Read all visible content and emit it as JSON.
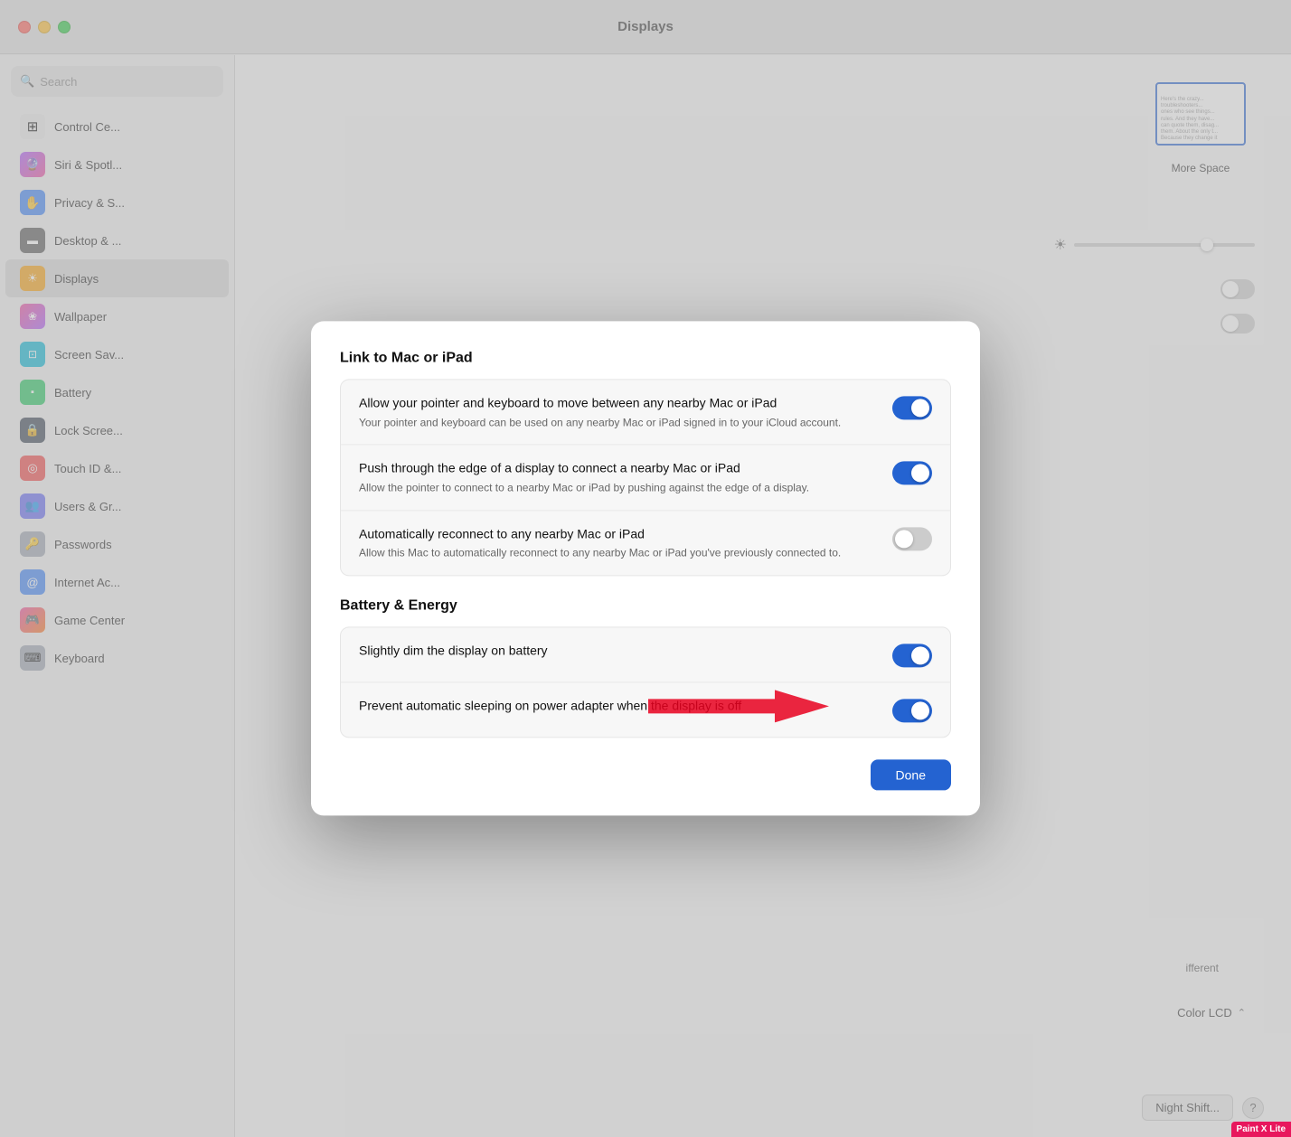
{
  "window": {
    "title": "Displays",
    "traffic_lights": {
      "close": "close",
      "minimize": "minimize",
      "zoom": "zoom"
    }
  },
  "sidebar": {
    "search_placeholder": "Search",
    "items": [
      {
        "id": "control-center",
        "label": "Control Ce...",
        "icon": "⊞",
        "color": "#888"
      },
      {
        "id": "siri-spotlight",
        "label": "Siri & Spotl...",
        "icon": "🔮",
        "color": "#a855f7"
      },
      {
        "id": "privacy",
        "label": "Privacy & S...",
        "icon": "✋",
        "color": "#2563eb"
      },
      {
        "id": "desktop",
        "label": "Desktop & ...",
        "icon": "▬",
        "color": "#555"
      },
      {
        "id": "displays",
        "label": "Displays",
        "icon": "☀",
        "color": "#f59e0b",
        "active": true
      },
      {
        "id": "wallpaper",
        "label": "Wallpaper",
        "icon": "❀",
        "color": "#ec4899"
      },
      {
        "id": "screensaver",
        "label": "Screen Sav...",
        "icon": "⊡",
        "color": "#06b6d4"
      },
      {
        "id": "battery",
        "label": "Battery",
        "icon": "▪",
        "color": "#22c55e"
      },
      {
        "id": "lock-screen",
        "label": "Lock Scree...",
        "icon": "🔒",
        "color": "#374151"
      },
      {
        "id": "touch-id",
        "label": "Touch ID &...",
        "icon": "◎",
        "color": "#ef4444"
      },
      {
        "id": "users",
        "label": "Users & Gr...",
        "icon": "👥",
        "color": "#6366f1"
      },
      {
        "id": "passwords",
        "label": "Passwords",
        "icon": "🔑",
        "color": "#555"
      },
      {
        "id": "internet",
        "label": "Internet Ac...",
        "icon": "@",
        "color": "#3b82f6"
      },
      {
        "id": "game-center",
        "label": "Game Center",
        "icon": "🎮",
        "color": "#ec4899"
      },
      {
        "id": "keyboard",
        "label": "Keyboard",
        "icon": "⌨",
        "color": "#888"
      }
    ]
  },
  "modal": {
    "link_section_title": "Link to Mac or iPad",
    "link_settings": [
      {
        "id": "pointer-keyboard",
        "title": "Allow your pointer and keyboard to move between any nearby Mac or iPad",
        "desc": "Your pointer and keyboard can be used on any nearby Mac or iPad signed in to your iCloud account.",
        "toggle": true
      },
      {
        "id": "push-edge",
        "title": "Push through the edge of a display to connect a nearby Mac or iPad",
        "desc": "Allow the pointer to connect to a nearby Mac or iPad by pushing against the edge of a display.",
        "toggle": true
      },
      {
        "id": "auto-reconnect",
        "title": "Automatically reconnect to any nearby Mac or iPad",
        "desc": "Allow this Mac to automatically reconnect to any nearby Mac or iPad you've previously connected to.",
        "toggle": false
      }
    ],
    "battery_section_title": "Battery & Energy",
    "battery_settings": [
      {
        "id": "dim-battery",
        "title": "Slightly dim the display on battery",
        "desc": "",
        "toggle": true
      },
      {
        "id": "prevent-sleep",
        "title": "Prevent automatic sleeping on power adapter when the display is off",
        "desc": "",
        "toggle": true
      }
    ],
    "done_button_label": "Done"
  },
  "display_panel": {
    "more_space_label": "More Space",
    "color_profile_label": "Color LCD",
    "night_shift_label": "Night Shift...",
    "brightness_label": "Brightness",
    "different_label": "ifferent"
  },
  "paint_badge": "Paint X Lite"
}
